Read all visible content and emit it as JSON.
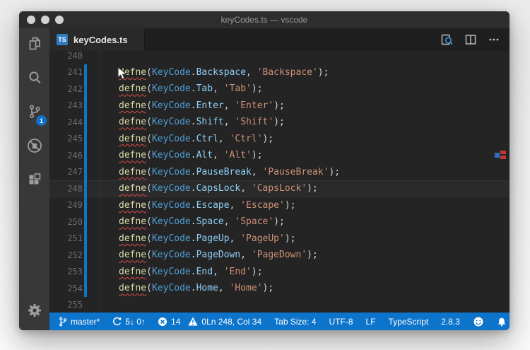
{
  "window": {
    "title": "keyCodes.ts — vscode",
    "controls": [
      "close-button",
      "minimize-button",
      "zoom-button"
    ]
  },
  "activity_bar": {
    "items": [
      "explorer",
      "search",
      "source-control",
      "debug",
      "extensions"
    ],
    "scm_badge": "1",
    "bottom": "settings"
  },
  "tab_bar": {
    "tab": {
      "label": "keyCodes.ts",
      "icon_text": "TS"
    },
    "actions": [
      "open-preview-icon",
      "split-editor-icon",
      "more-actions-icon"
    ]
  },
  "editor": {
    "language": "typescript",
    "current_line": 248,
    "lines": [
      {
        "num": 240
      },
      {
        "num": 241,
        "fn": "defne",
        "obj": "KeyCode",
        "member": "Backspace",
        "str": "Backspace",
        "modified": true
      },
      {
        "num": 242,
        "fn": "defne",
        "obj": "KeyCode",
        "member": "Tab",
        "str": "Tab",
        "modified": true
      },
      {
        "num": 243,
        "fn": "defne",
        "obj": "KeyCode",
        "member": "Enter",
        "str": "Enter",
        "modified": true
      },
      {
        "num": 244,
        "fn": "defne",
        "obj": "KeyCode",
        "member": "Shift",
        "str": "Shift",
        "modified": true
      },
      {
        "num": 245,
        "fn": "defne",
        "obj": "KeyCode",
        "member": "Ctrl",
        "str": "Ctrl",
        "modified": true
      },
      {
        "num": 246,
        "fn": "defne",
        "obj": "KeyCode",
        "member": "Alt",
        "str": "Alt",
        "modified": true
      },
      {
        "num": 247,
        "fn": "defne",
        "obj": "KeyCode",
        "member": "PauseBreak",
        "str": "PauseBreak",
        "modified": true
      },
      {
        "num": 248,
        "fn": "defne",
        "obj": "KeyCode",
        "member": "CapsLock",
        "str": "CapsLock",
        "modified": true
      },
      {
        "num": 249,
        "fn": "defne",
        "obj": "KeyCode",
        "member": "Escape",
        "str": "Escape",
        "modified": true
      },
      {
        "num": 250,
        "fn": "defne",
        "obj": "KeyCode",
        "member": "Space",
        "str": "Space",
        "modified": true
      },
      {
        "num": 251,
        "fn": "defne",
        "obj": "KeyCode",
        "member": "PageUp",
        "str": "PageUp",
        "modified": true
      },
      {
        "num": 252,
        "fn": "defne",
        "obj": "KeyCode",
        "member": "PageDown",
        "str": "PageDown",
        "modified": true
      },
      {
        "num": 253,
        "fn": "defne",
        "obj": "KeyCode",
        "member": "End",
        "str": "End",
        "modified": true
      },
      {
        "num": 254,
        "fn": "defne",
        "obj": "KeyCode",
        "member": "Home",
        "str": "Home",
        "modified": true
      },
      {
        "num": 255
      }
    ]
  },
  "status_bar": {
    "branch": "master*",
    "sync": "5↓ 0↑",
    "errors": "14",
    "warnings": "0",
    "position": "Ln 248, Col 34",
    "tab_size": "Tab Size: 4",
    "encoding": "UTF-8",
    "eol": "LF",
    "language": "TypeScript",
    "version": "2.8.3"
  },
  "colors": {
    "statusbar": "#0d74cc",
    "badge": "#0e70c8",
    "token_function": "#dcdcaa",
    "token_class": "#4fa0d8",
    "token_member": "#8fd0f8",
    "token_string": "#ce9178",
    "error_squiggle": "#e14a4a",
    "modified_gutter": "#0f77c2"
  }
}
